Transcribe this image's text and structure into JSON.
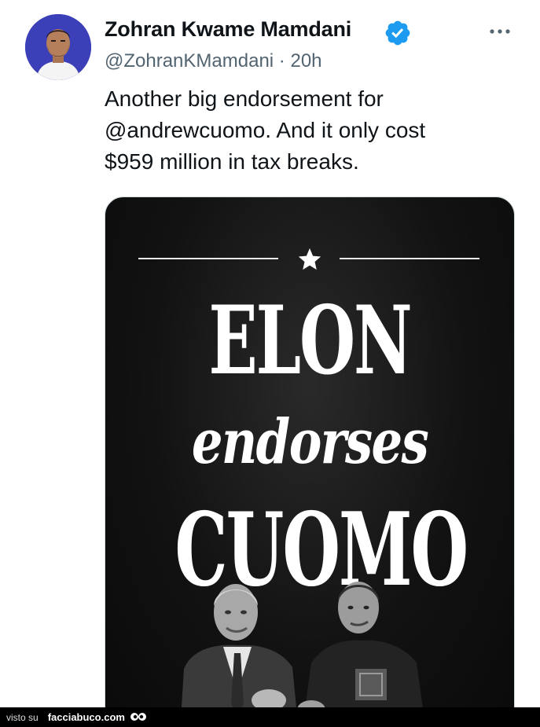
{
  "tweet": {
    "display_name": "Zohran Kwame Mamdani",
    "handle": "@ZohranKMamdani",
    "separator": "·",
    "time": "20h",
    "text_lines": [
      "Another big endorsement for",
      "@andrewcuomo.  And it only cost",
      "$959 million in tax breaks."
    ]
  },
  "media": {
    "headline_top": "ELON",
    "headline_middle": "endorses",
    "headline_bottom": "CUOMO"
  },
  "footer": {
    "prefix": "visto su",
    "site": "facciabuco.com"
  },
  "colors": {
    "verified_badge": "#1d9bf0",
    "avatar_background": "#3b3fb8",
    "secondary_text": "#536471",
    "media_background": "#111111"
  },
  "icons": {
    "verified": "verified-badge-icon",
    "more": "more-options-icon",
    "star": "star-icon"
  }
}
